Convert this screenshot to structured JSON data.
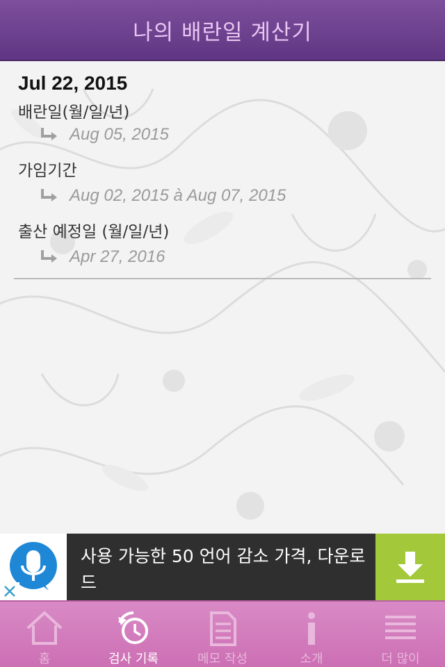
{
  "header": {
    "title": "나의 배란일 계산기"
  },
  "record": {
    "date": "Jul 22, 2015",
    "rows": [
      {
        "label": "배란일(월/일/년)",
        "value": "Aug 05, 2015"
      },
      {
        "label": "가임기간",
        "value": "Aug 02, 2015 à Aug 07, 2015"
      },
      {
        "label": "출산 예정일 (월/일/년)",
        "value": "Apr 27, 2016"
      }
    ]
  },
  "ad": {
    "text": "사용 가능한 50 언어 감소 가격, 다운로드",
    "icons": [
      "microphone-icon",
      "download-icon",
      "close-icon"
    ]
  },
  "tabs": [
    {
      "label": "홈",
      "icon": "home-icon"
    },
    {
      "label": "검사 기록",
      "icon": "history-icon"
    },
    {
      "label": "메모 작성",
      "icon": "note-icon"
    },
    {
      "label": "소개",
      "icon": "info-icon"
    },
    {
      "label": "더 많이",
      "icon": "menu-icon"
    }
  ],
  "colors": {
    "header": "#6b3f8c",
    "header_text": "#e9c6f2",
    "tabbar": "#d17ab9",
    "ad_green": "#a3c93a",
    "ad_blue": "#1e88d6"
  }
}
